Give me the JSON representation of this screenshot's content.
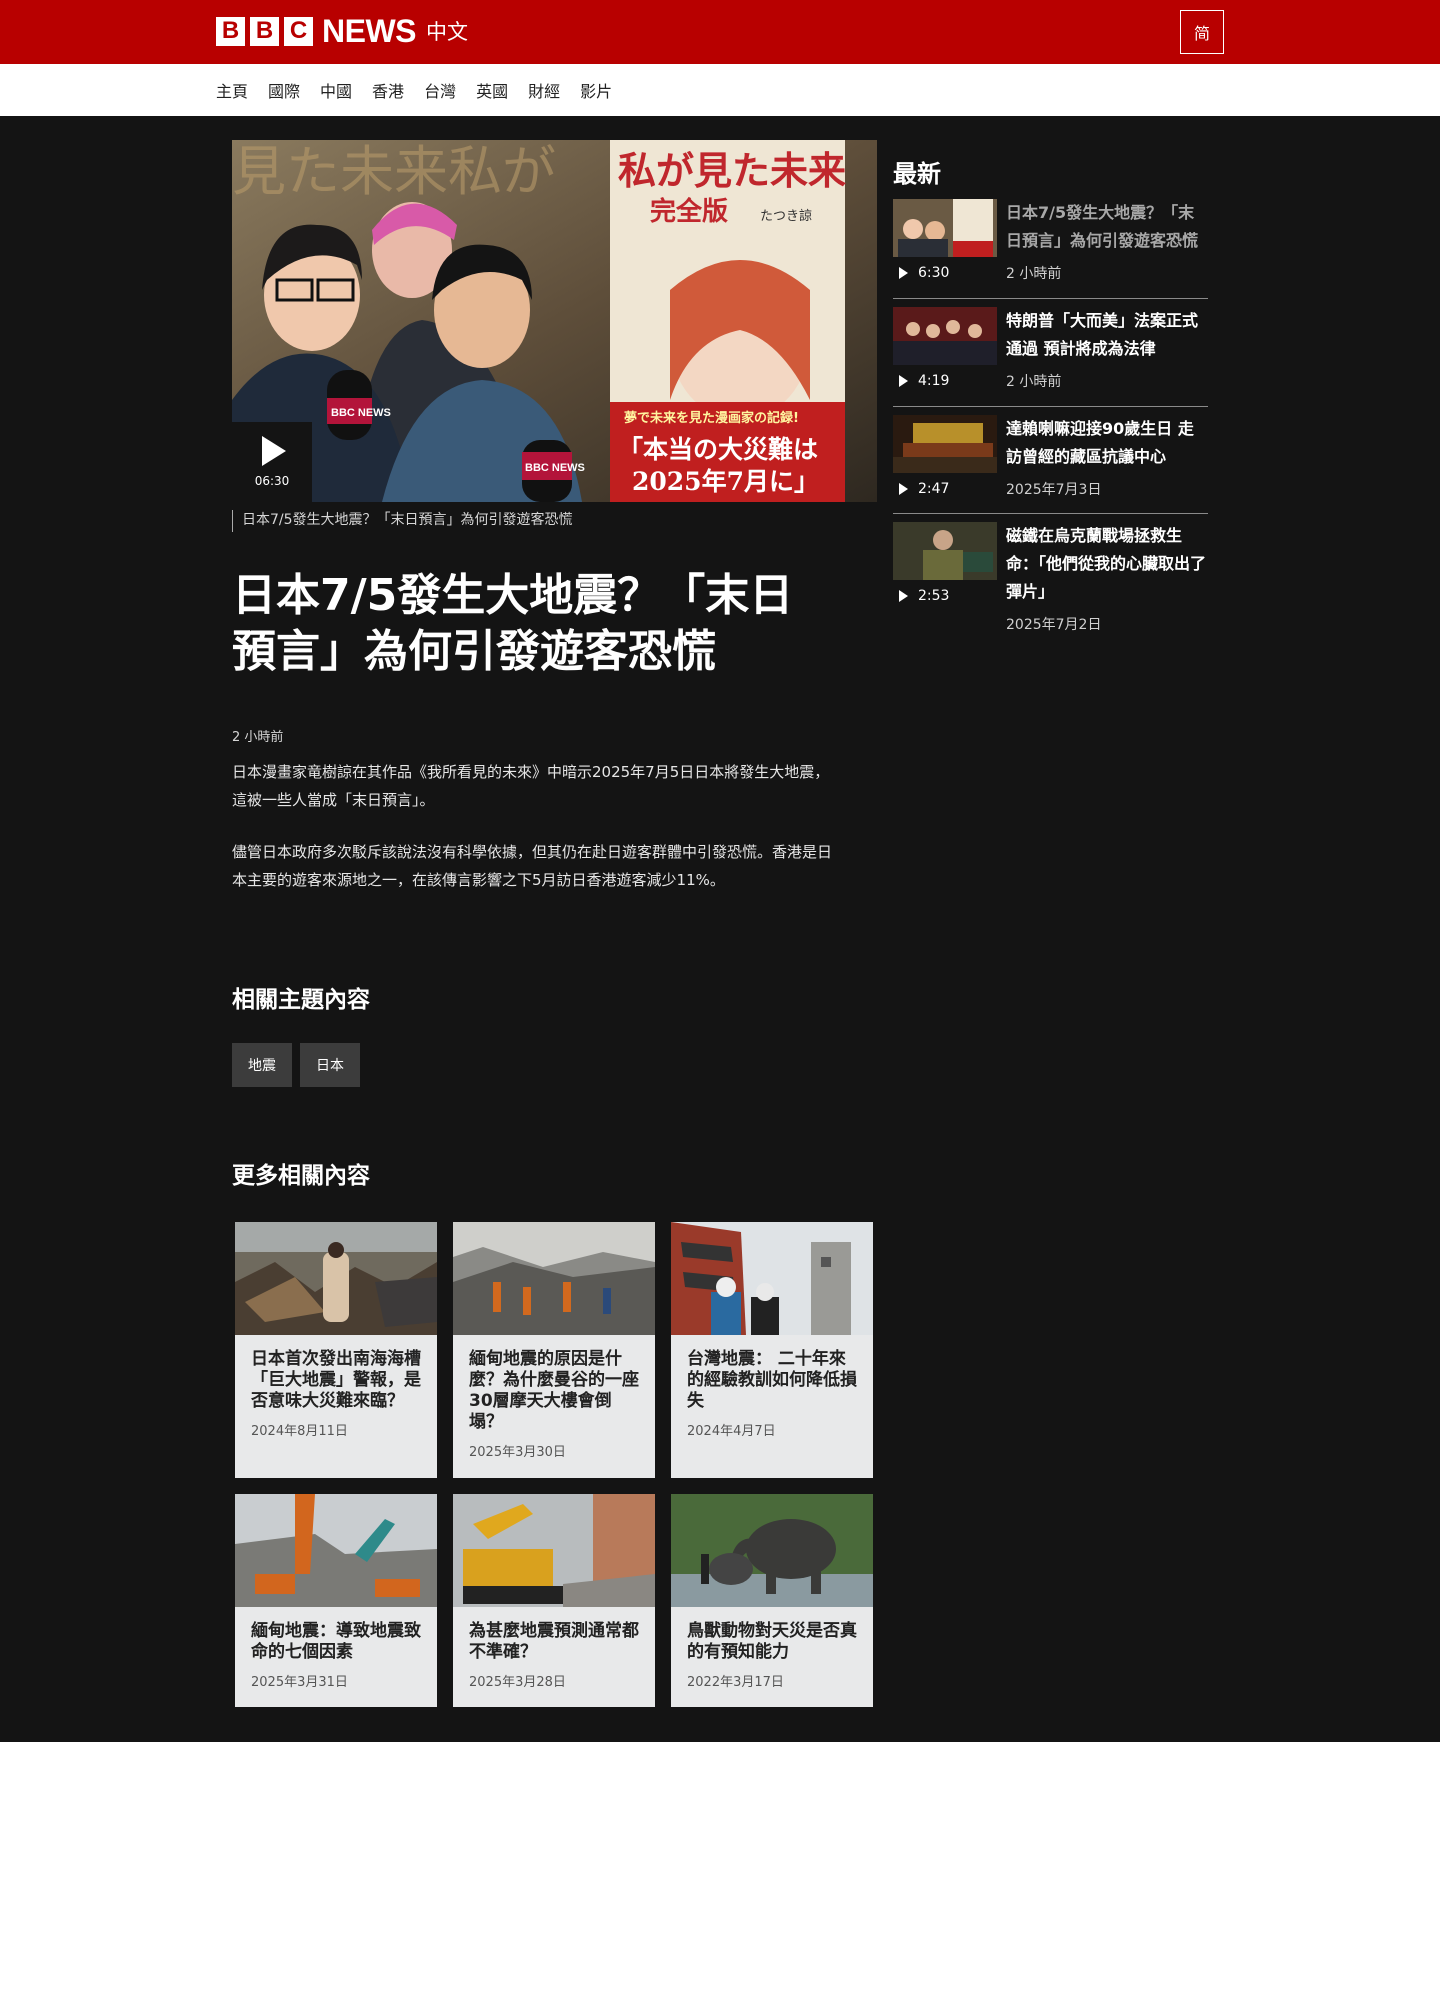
{
  "header": {
    "logo_letters": [
      "B",
      "B",
      "C"
    ],
    "logo_news": "NEWS",
    "logo_lang": "中文",
    "lang_toggle": "简",
    "brand_color": "#b80000"
  },
  "nav": {
    "items": [
      "主頁",
      "國際",
      "中國",
      "香港",
      "台灣",
      "英國",
      "財經",
      "影片"
    ]
  },
  "video": {
    "duration": "06:30",
    "caption": "日本7/5發生大地震？「末日預言」為何引發遊客恐慌",
    "thumb_text": {
      "bg_text": "見た未来私が",
      "book_title": "私が見た未来",
      "book_sub": "完全版",
      "book_author": "たつき諒",
      "banner_line": "夢で未来を見た漫画家の記録!",
      "banner_big1": "「本当の大災難は",
      "banner_big2": "2025年7月に」",
      "mic_label": "BBC NEWS"
    }
  },
  "article": {
    "headline": "日本7/5發生大地震？「末日預言」為何引發遊客恐慌",
    "timestamp": "2 小時前",
    "paragraphs": [
      "日本漫畫家竜樹諒在其作品《我所看見的未來》中暗示2025年7月5日日本將發生大地震，這被一些人當成「末日預言」。",
      "儘管日本政府多次駁斥該說法沒有科學依據，但其仍在赴日遊客群體中引發恐慌。香港是日本主要的遊客來源地之一，在該傳言影響之下5月訪日香港遊客減少11%。"
    ]
  },
  "related_topics": {
    "heading": "相關主題內容",
    "tags": [
      "地震",
      "日本"
    ]
  },
  "more_related": {
    "heading": "更多相關內容",
    "cards": [
      {
        "title": "日本首次發出南海海槽「巨大地震」警報，是否意味大災難來臨？",
        "date": "2024年8月11日"
      },
      {
        "title": "緬甸地震的原因是什麼？為什麼曼谷的一座30層摩天大樓會倒塌？",
        "date": "2025年3月30日"
      },
      {
        "title": "台灣地震： 二十年來的經驗教訓如何降低損失",
        "date": "2024年4月7日"
      },
      {
        "title": "緬甸地震：導致地震致命的七個因素",
        "date": "2025年3月31日"
      },
      {
        "title": "為甚麼地震預測通常都不準確？",
        "date": "2025年3月28日"
      },
      {
        "title": "鳥獸動物對天災是否真的有預知能力",
        "date": "2022年3月17日"
      }
    ]
  },
  "latest": {
    "heading": "最新",
    "items": [
      {
        "title": "日本7/5發生大地震？「末日預言」為何引發遊客恐慌",
        "duration": "6:30",
        "date": "2 小時前",
        "current": true
      },
      {
        "title": "特朗普「大而美」法案正式通過 預計將成為法律",
        "duration": "4:19",
        "date": "2 小時前",
        "current": false
      },
      {
        "title": "達賴喇嘛迎接90歲生日 走訪曾經的藏區抗議中心",
        "duration": "2:47",
        "date": "2025年7月3日",
        "current": false
      },
      {
        "title": "磁鐵在烏克蘭戰場拯救生命：「他們從我的心臟取出了彈片」",
        "duration": "2:53",
        "date": "2025年7月2日",
        "current": false
      }
    ]
  }
}
